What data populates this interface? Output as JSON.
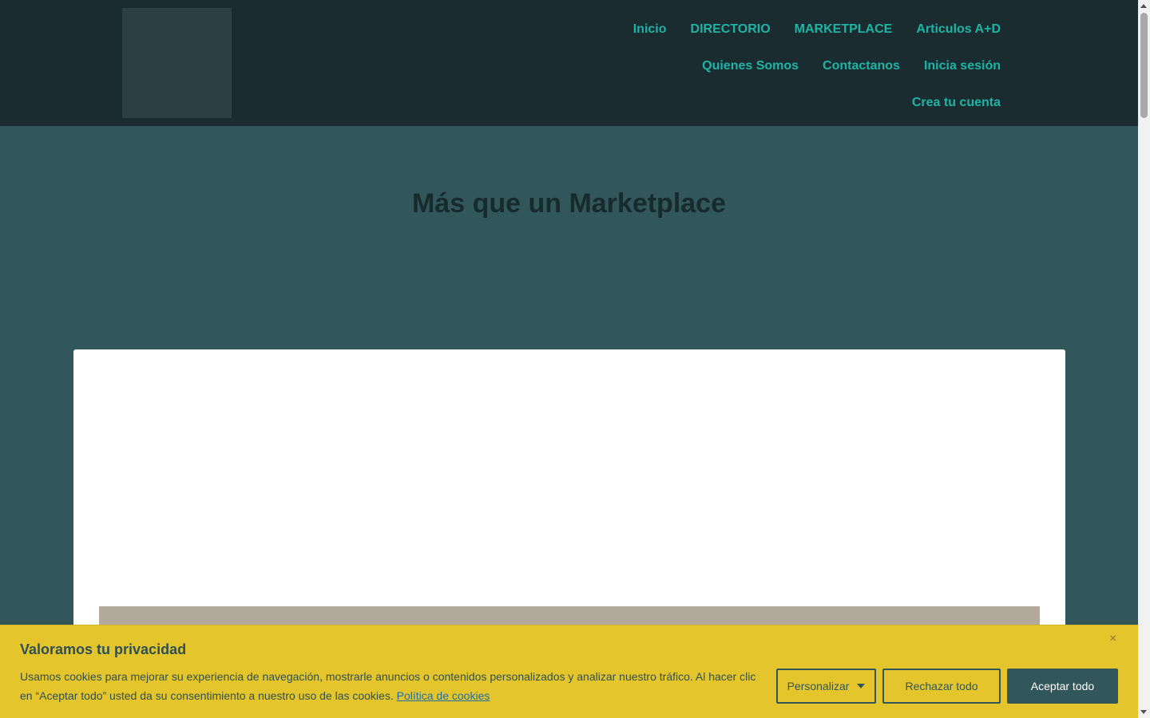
{
  "nav": {
    "row1": [
      "Inicio",
      "DIRECTORIO",
      "MARKETPLACE",
      "Articulos A+D"
    ],
    "row2": [
      "Quienes Somos",
      "Contactanos",
      "Inicia sesión"
    ],
    "row3": [
      "Crea tu cuenta"
    ]
  },
  "hero": {
    "title": "Más que un Marketplace"
  },
  "cookie": {
    "title": "Valoramos tu privacidad",
    "text": "Usamos cookies para mejorar su experiencia de navegación, mostrarle anuncios o contenidos personalizados y analizar nuestro tráfico. Al hacer clic en “Aceptar todo” usted da su consentimiento a nuestro uso de las cookies.",
    "policy_link": "Política de cookies",
    "close": "×",
    "customize": "Personalizar",
    "reject": "Rechazar todo",
    "accept": "Aceptar todo"
  },
  "colors": {
    "header_bg": "#1b2c30",
    "page_bg": "#31575b",
    "nav_link": "#1fb3a5",
    "cookie_bg": "#e5c52c",
    "primary": "#31575b"
  },
  "icons": {
    "close": "close-icon",
    "dropdown": "caret-down-icon"
  }
}
